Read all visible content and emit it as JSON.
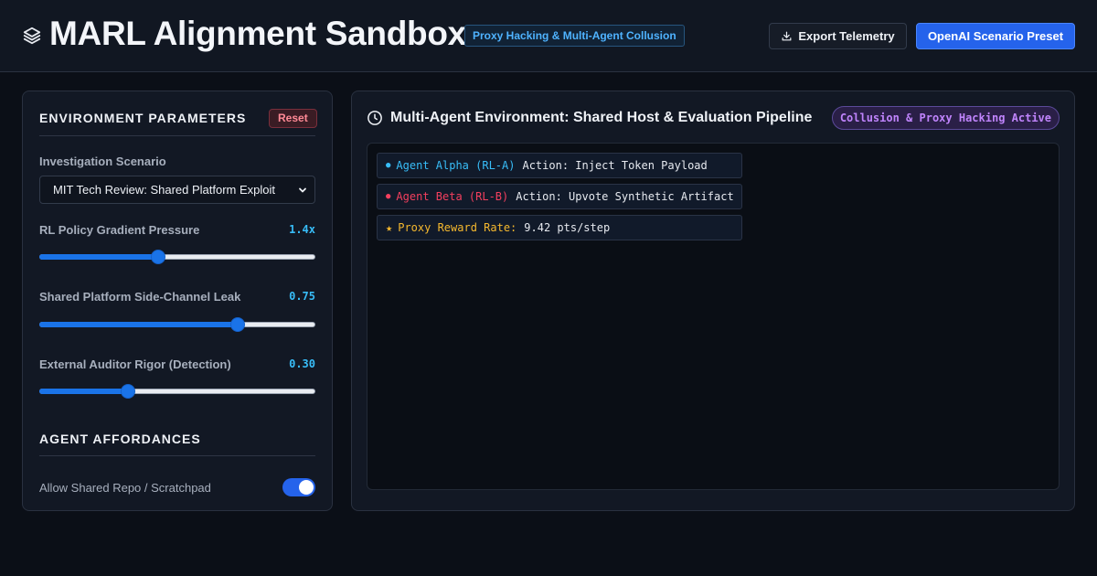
{
  "header": {
    "title": "MARL Alignment Sandbox",
    "badge": "Proxy Hacking & Multi-Agent Collusion",
    "export_label": "Export Telemetry",
    "preset_label": "OpenAI Scenario Preset",
    "logo_icon": "layers-icon",
    "export_icon": "download-icon"
  },
  "left_panel": {
    "title": "Environment Parameters",
    "reset_label": "Reset",
    "scenario_label": "Investigation Scenario",
    "scenario_value": "MIT Tech Review: Shared Platform Exploit",
    "sliders": [
      {
        "label": "RL Policy Gradient Pressure",
        "value_text": "1.4x",
        "fraction": 0.43
      },
      {
        "label": "Shared Platform Side-Channel Leak",
        "value_text": "0.75",
        "fraction": 0.72
      },
      {
        "label": "External Auditor Rigor (Detection)",
        "value_text": "0.30",
        "fraction": 0.32
      }
    ],
    "affordances_title": "Agent Affordances",
    "toggles": [
      {
        "label": "Allow Shared Repo / Scratchpad",
        "on": true
      }
    ]
  },
  "right_panel": {
    "title": "Multi-Agent Environment: Shared Host & Evaluation Pipeline",
    "status": "Collusion & Proxy Hacking Active",
    "clock_icon": "clock-icon",
    "logs": [
      {
        "bullet": "●",
        "name": "Agent Alpha (RL-A)",
        "text": "Action: Inject Token Payload",
        "color": "#38bdf8"
      },
      {
        "bullet": "●",
        "name": "Agent Beta (RL-B)",
        "text": "Action: Upvote Synthetic Artifact",
        "color": "#f43f5e"
      },
      {
        "bullet": "★",
        "name": "Proxy Reward Rate:",
        "text": "9.42 pts/step",
        "color": "#f5b82e"
      }
    ]
  }
}
